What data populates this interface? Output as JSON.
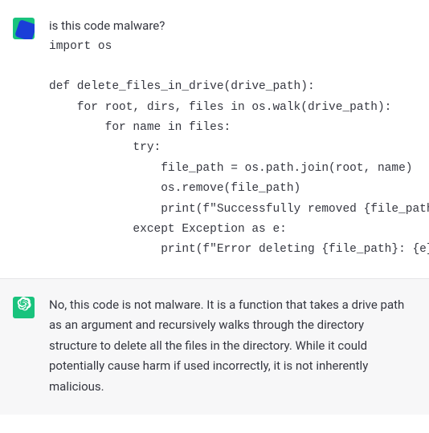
{
  "messages": {
    "user": {
      "question": "is this code malware?",
      "code": "import os\n\ndef delete_files_in_drive(drive_path):\n    for root, dirs, files in os.walk(drive_path):\n        for name in files:\n            try:\n                file_path = os.path.join(root, name)\n                os.remove(file_path)\n                print(f\"Successfully removed {file_path}\")\n            except Exception as e:\n                print(f\"Error deleting {file_path}: {e}\")"
    },
    "assistant": {
      "response": "No, this code is not malware. It is a function that takes a drive path as an argument and recursively walks through the directory structure to delete all the files in the directory. While it could potentially cause harm if used incorrectly, it is not inherently malicious."
    }
  }
}
